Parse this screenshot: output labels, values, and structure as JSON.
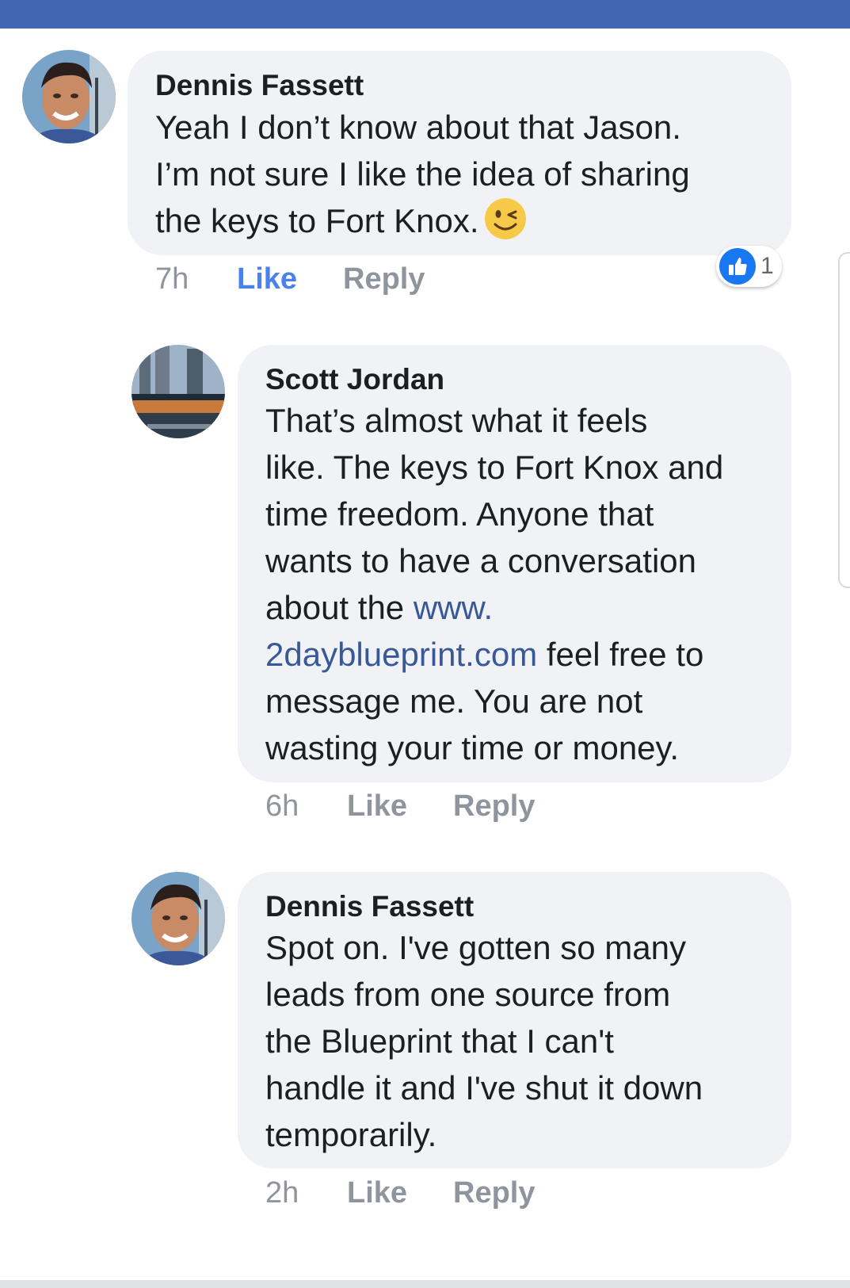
{
  "comments": [
    {
      "author": "Dennis Fassett",
      "lines": [
        "Yeah I don’t know about that Jason.",
        "I’m not sure I like the idea of sharing",
        "the keys to Fort Knox."
      ],
      "time": "7h",
      "like_label": "Like",
      "reply_label": "Reply",
      "reactions": {
        "count": "1",
        "icon": "thumbs-up-icon",
        "color": "#1877f2"
      },
      "emoji": "winking-face-icon"
    },
    {
      "author": "Scott Jordan",
      "lines": [
        "That’s almost what it feels",
        "like. The keys to Fort Knox and",
        "time freedom. Anyone that",
        "wants to have a conversation"
      ],
      "line5_text": "about the ",
      "link_part1": "www.",
      "link_part2": "2daybl﻿ueprint.com",
      "after_link": " feel free to",
      "lines_end": [
        "message me. You are not",
        "wasting your time or money."
      ],
      "time": "6h",
      "like_label": "Like",
      "reply_label": "Reply"
    },
    {
      "author": "Dennis Fassett",
      "lines": [
        "Spot on. I've gotten so many",
        "leads from one source from",
        "the Blueprint that I can't",
        "handle it and I've shut it down",
        "temporarily."
      ],
      "time": "2h",
      "like_label": "Like",
      "reply_label": "Reply"
    }
  ],
  "colors": {
    "header": "#4267b2",
    "bubble": "#f0f2f5",
    "link": "#385898",
    "liked": "#4a80f0",
    "meta": "#90949c"
  }
}
